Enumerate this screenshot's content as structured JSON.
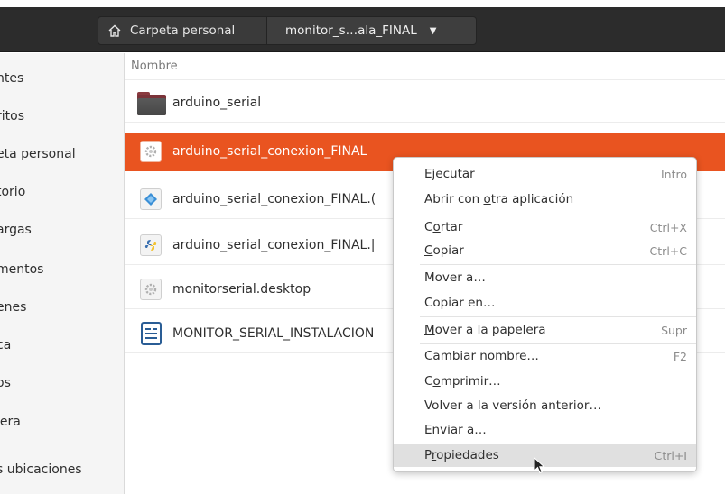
{
  "header": {
    "home_label": "Carpeta personal",
    "current_label": "monitor_s…ala_FINAL",
    "caret": "▼"
  },
  "sidebar": {
    "items": [
      {
        "label": "ntes"
      },
      {
        "label": "ritos"
      },
      {
        "label": "eta personal"
      },
      {
        "label": "torio"
      },
      {
        "label": "argas"
      },
      {
        "label": "mentos"
      },
      {
        "label": "enes"
      },
      {
        "label": "ca"
      },
      {
        "label": "os"
      },
      {
        "label": "lera"
      },
      {
        "label": "s ubicaciones"
      }
    ]
  },
  "list": {
    "column_name": "Nombre",
    "rows": [
      {
        "name": "arduino_serial",
        "icon": "folder-icon"
      },
      {
        "name": "arduino_serial_conexion_FINAL",
        "icon": "gear-icon",
        "selected": true
      },
      {
        "name": "arduino_serial_conexion_FINAL.(",
        "icon": "arduino-icon"
      },
      {
        "name": "arduino_serial_conexion_FINAL.|",
        "icon": "python-icon"
      },
      {
        "name": "monitorserial.desktop",
        "icon": "gear-icon"
      },
      {
        "name": "MONITOR_SERIAL_INSTALACION",
        "icon": "document-icon"
      }
    ]
  },
  "context_menu": {
    "items": {
      "ejecutar": {
        "pre": "Ejecutar",
        "u": "",
        "post": "",
        "accel": "Intro"
      },
      "abrir": {
        "pre": "Abrir con ",
        "u": "o",
        "post": "tra aplicación",
        "accel": ""
      },
      "cortar": {
        "pre": "C",
        "u": "o",
        "post": "rtar",
        "accel": "Ctrl+X"
      },
      "copiar": {
        "pre": "",
        "u": "C",
        "post": "opiar",
        "accel": "Ctrl+C"
      },
      "mover": {
        "pre": "Mover a…",
        "u": "",
        "post": "",
        "accel": ""
      },
      "copiar_en": {
        "pre": "Copiar en…",
        "u": "",
        "post": "",
        "accel": ""
      },
      "papelera": {
        "pre": "",
        "u": "M",
        "post": "over a la papelera",
        "accel": "Supr"
      },
      "renombrar": {
        "pre": "Ca",
        "u": "m",
        "post": "biar nombre…",
        "accel": "F2"
      },
      "comprimir": {
        "pre": "C",
        "u": "o",
        "post": "mprimir…",
        "accel": ""
      },
      "volver": {
        "pre": "Volver a la versión anterior…",
        "u": "",
        "post": "",
        "accel": ""
      },
      "enviar": {
        "pre": "Enviar a…",
        "u": "",
        "post": "",
        "accel": ""
      },
      "propiedades": {
        "pre": "P",
        "u": "r",
        "post": "opiedades",
        "accel": "Ctrl+I"
      }
    }
  },
  "colors": {
    "accent": "#e95420",
    "headerbar": "#2c2c2c"
  }
}
